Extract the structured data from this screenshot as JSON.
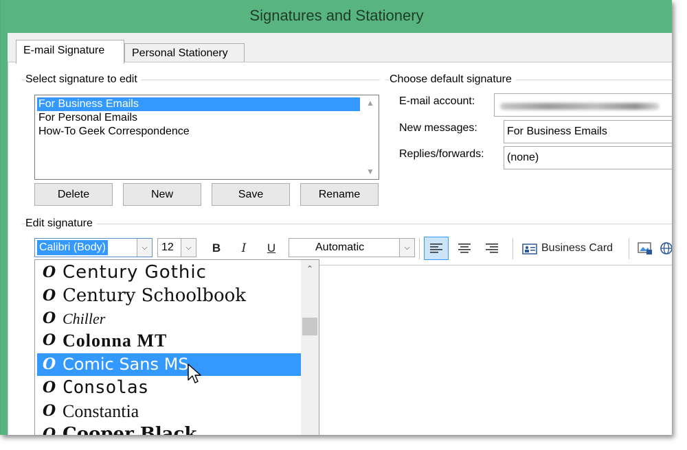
{
  "window": {
    "title": "Signatures and Stationery"
  },
  "tabs": [
    {
      "label": "E-mail Signature",
      "active": true
    },
    {
      "label": "Personal Stationery",
      "active": false
    }
  ],
  "select_section": {
    "label": "Select signature to edit",
    "items": [
      {
        "label": "For Business Emails",
        "selected": true
      },
      {
        "label": "For Personal Emails",
        "selected": false
      },
      {
        "label": "How-To Geek Correspondence",
        "selected": false
      }
    ],
    "buttons": {
      "delete": "Delete",
      "new": "New",
      "save": "Save",
      "rename": "Rename"
    }
  },
  "default_section": {
    "label": "Choose default signature",
    "account_label": "E-mail account:",
    "new_messages_label": "New messages:",
    "new_messages_value": "For Business Emails",
    "replies_label": "Replies/forwards:",
    "replies_value": "(none)"
  },
  "edit_section": {
    "label": "Edit signature",
    "font": "Calibri (Body)",
    "size": "12",
    "color": "Automatic",
    "bold": "B",
    "italic": "I",
    "underline": "U",
    "business_card": "Business Card"
  },
  "font_dropdown": {
    "items": [
      {
        "name": "Century Gothic",
        "selected": false
      },
      {
        "name": "Century Schoolbook",
        "selected": false
      },
      {
        "name": "Chiller",
        "selected": false
      },
      {
        "name": "Colonna MT",
        "selected": false
      },
      {
        "name": "Comic Sans MS",
        "selected": true
      },
      {
        "name": "Consolas",
        "selected": false
      },
      {
        "name": "Constantia",
        "selected": false
      },
      {
        "name": "Cooper Black",
        "selected": false
      }
    ],
    "icon_glyph": "O"
  },
  "colors": {
    "title_bar": "#59b57f",
    "selection": "#3399ff"
  }
}
